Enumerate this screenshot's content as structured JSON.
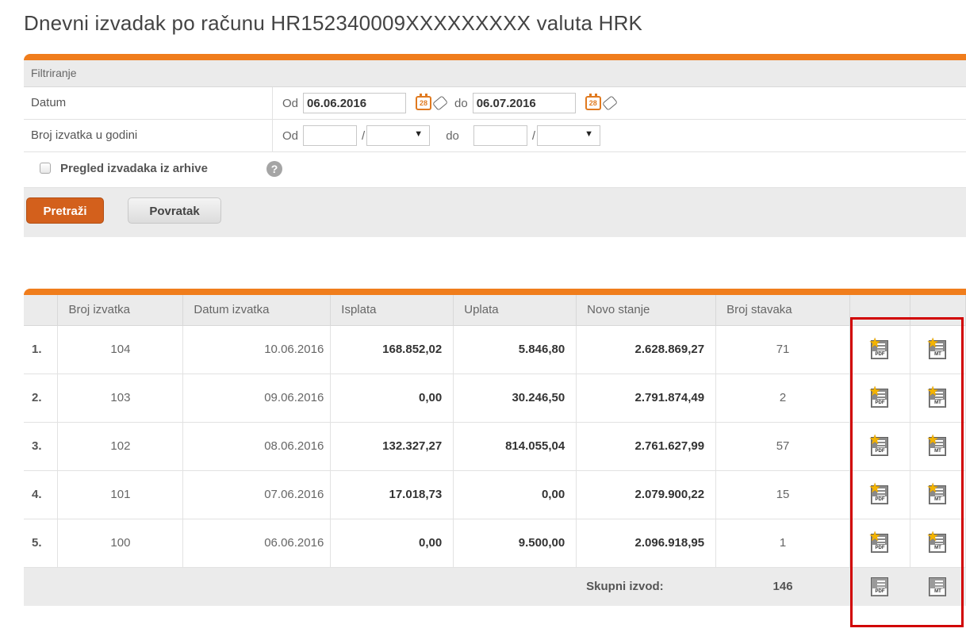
{
  "page": {
    "title": "Dnevni izvadak po računu  HR152340009XXXXXXXXX valuta HRK"
  },
  "filter": {
    "header": "Filtriranje",
    "date_label": "Datum",
    "date_from_label": "Od",
    "date_from_value": "06.06.2016",
    "date_to_label": "do",
    "date_to_value": "06.07.2016",
    "calendar_icon_text": "28",
    "number_label": "Broj izvatka u godini",
    "number_from_label": "Od",
    "number_to_label": "do",
    "slash": "/",
    "archive_label": "Pregled izvadaka iz arhive",
    "help_icon_text": "?",
    "search_button": "Pretraži",
    "back_button": "Povratak"
  },
  "table": {
    "columns": [
      "",
      "Broj izvatka",
      "Datum izvatka",
      "Isplata",
      "Uplata",
      "Novo stanje",
      "Broj stavaka",
      "",
      ""
    ],
    "rows": [
      {
        "rownum": "1.",
        "number": "104",
        "date": "10.06.2016",
        "debit": "168.852,02",
        "credit": "5.846,80",
        "balance": "2.628.869,27",
        "items": "71"
      },
      {
        "rownum": "2.",
        "number": "103",
        "date": "09.06.2016",
        "debit": "0,00",
        "credit": "30.246,50",
        "balance": "2.791.874,49",
        "items": "2"
      },
      {
        "rownum": "3.",
        "number": "102",
        "date": "08.06.2016",
        "debit": "132.327,27",
        "credit": "814.055,04",
        "balance": "2.761.627,99",
        "items": "57"
      },
      {
        "rownum": "4.",
        "number": "101",
        "date": "07.06.2016",
        "debit": "17.018,73",
        "credit": "0,00",
        "balance": "2.079.900,22",
        "items": "15"
      },
      {
        "rownum": "5.",
        "number": "100",
        "date": "06.06.2016",
        "debit": "0,00",
        "credit": "9.500,00",
        "balance": "2.096.918,95",
        "items": "1"
      }
    ],
    "footer": {
      "label": "Skupni izvod:",
      "total_items": "146"
    },
    "icon_tags": {
      "pdf": "PDF",
      "mt": "MT"
    }
  },
  "colors": {
    "accent": "#f07d1c",
    "button": "#d3601c",
    "highlight": "#d10000"
  },
  "icons": {
    "calendar": "calendar-icon",
    "eraser": "eraser-icon",
    "help": "help-icon",
    "pdf": "pdf-download-icon",
    "mt": "mt940-download-icon"
  }
}
